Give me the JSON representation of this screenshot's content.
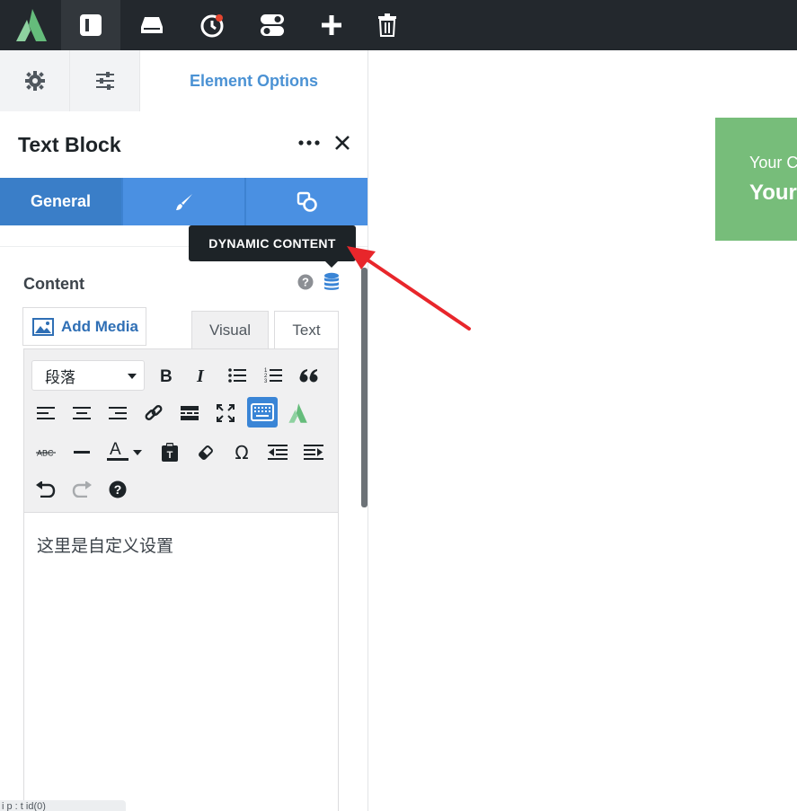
{
  "topbar": {
    "buttons": [
      "layout-icon",
      "inbox-icon",
      "history-icon",
      "toggles-icon",
      "plus-icon",
      "trash-icon"
    ]
  },
  "sidebar": {
    "tab_title": "Element Options",
    "element_name": "Text Block",
    "option_tabs": {
      "general": "General"
    },
    "tooltip": "DYNAMIC CONTENT",
    "content_label": "Content",
    "add_media": "Add Media",
    "editor_tabs": {
      "visual": "Visual",
      "text": "Text"
    },
    "format_select": "段落",
    "editor_text": "这里是自定义设置",
    "status_path": "i   p   :    t    id(0)"
  },
  "preview": {
    "line1": "Your C",
    "line2": "Your"
  },
  "colors": {
    "accent": "#4a90e2",
    "dark_bar": "#23282d",
    "preview_bg": "#77bd7a",
    "annotation": "#e8262b"
  }
}
